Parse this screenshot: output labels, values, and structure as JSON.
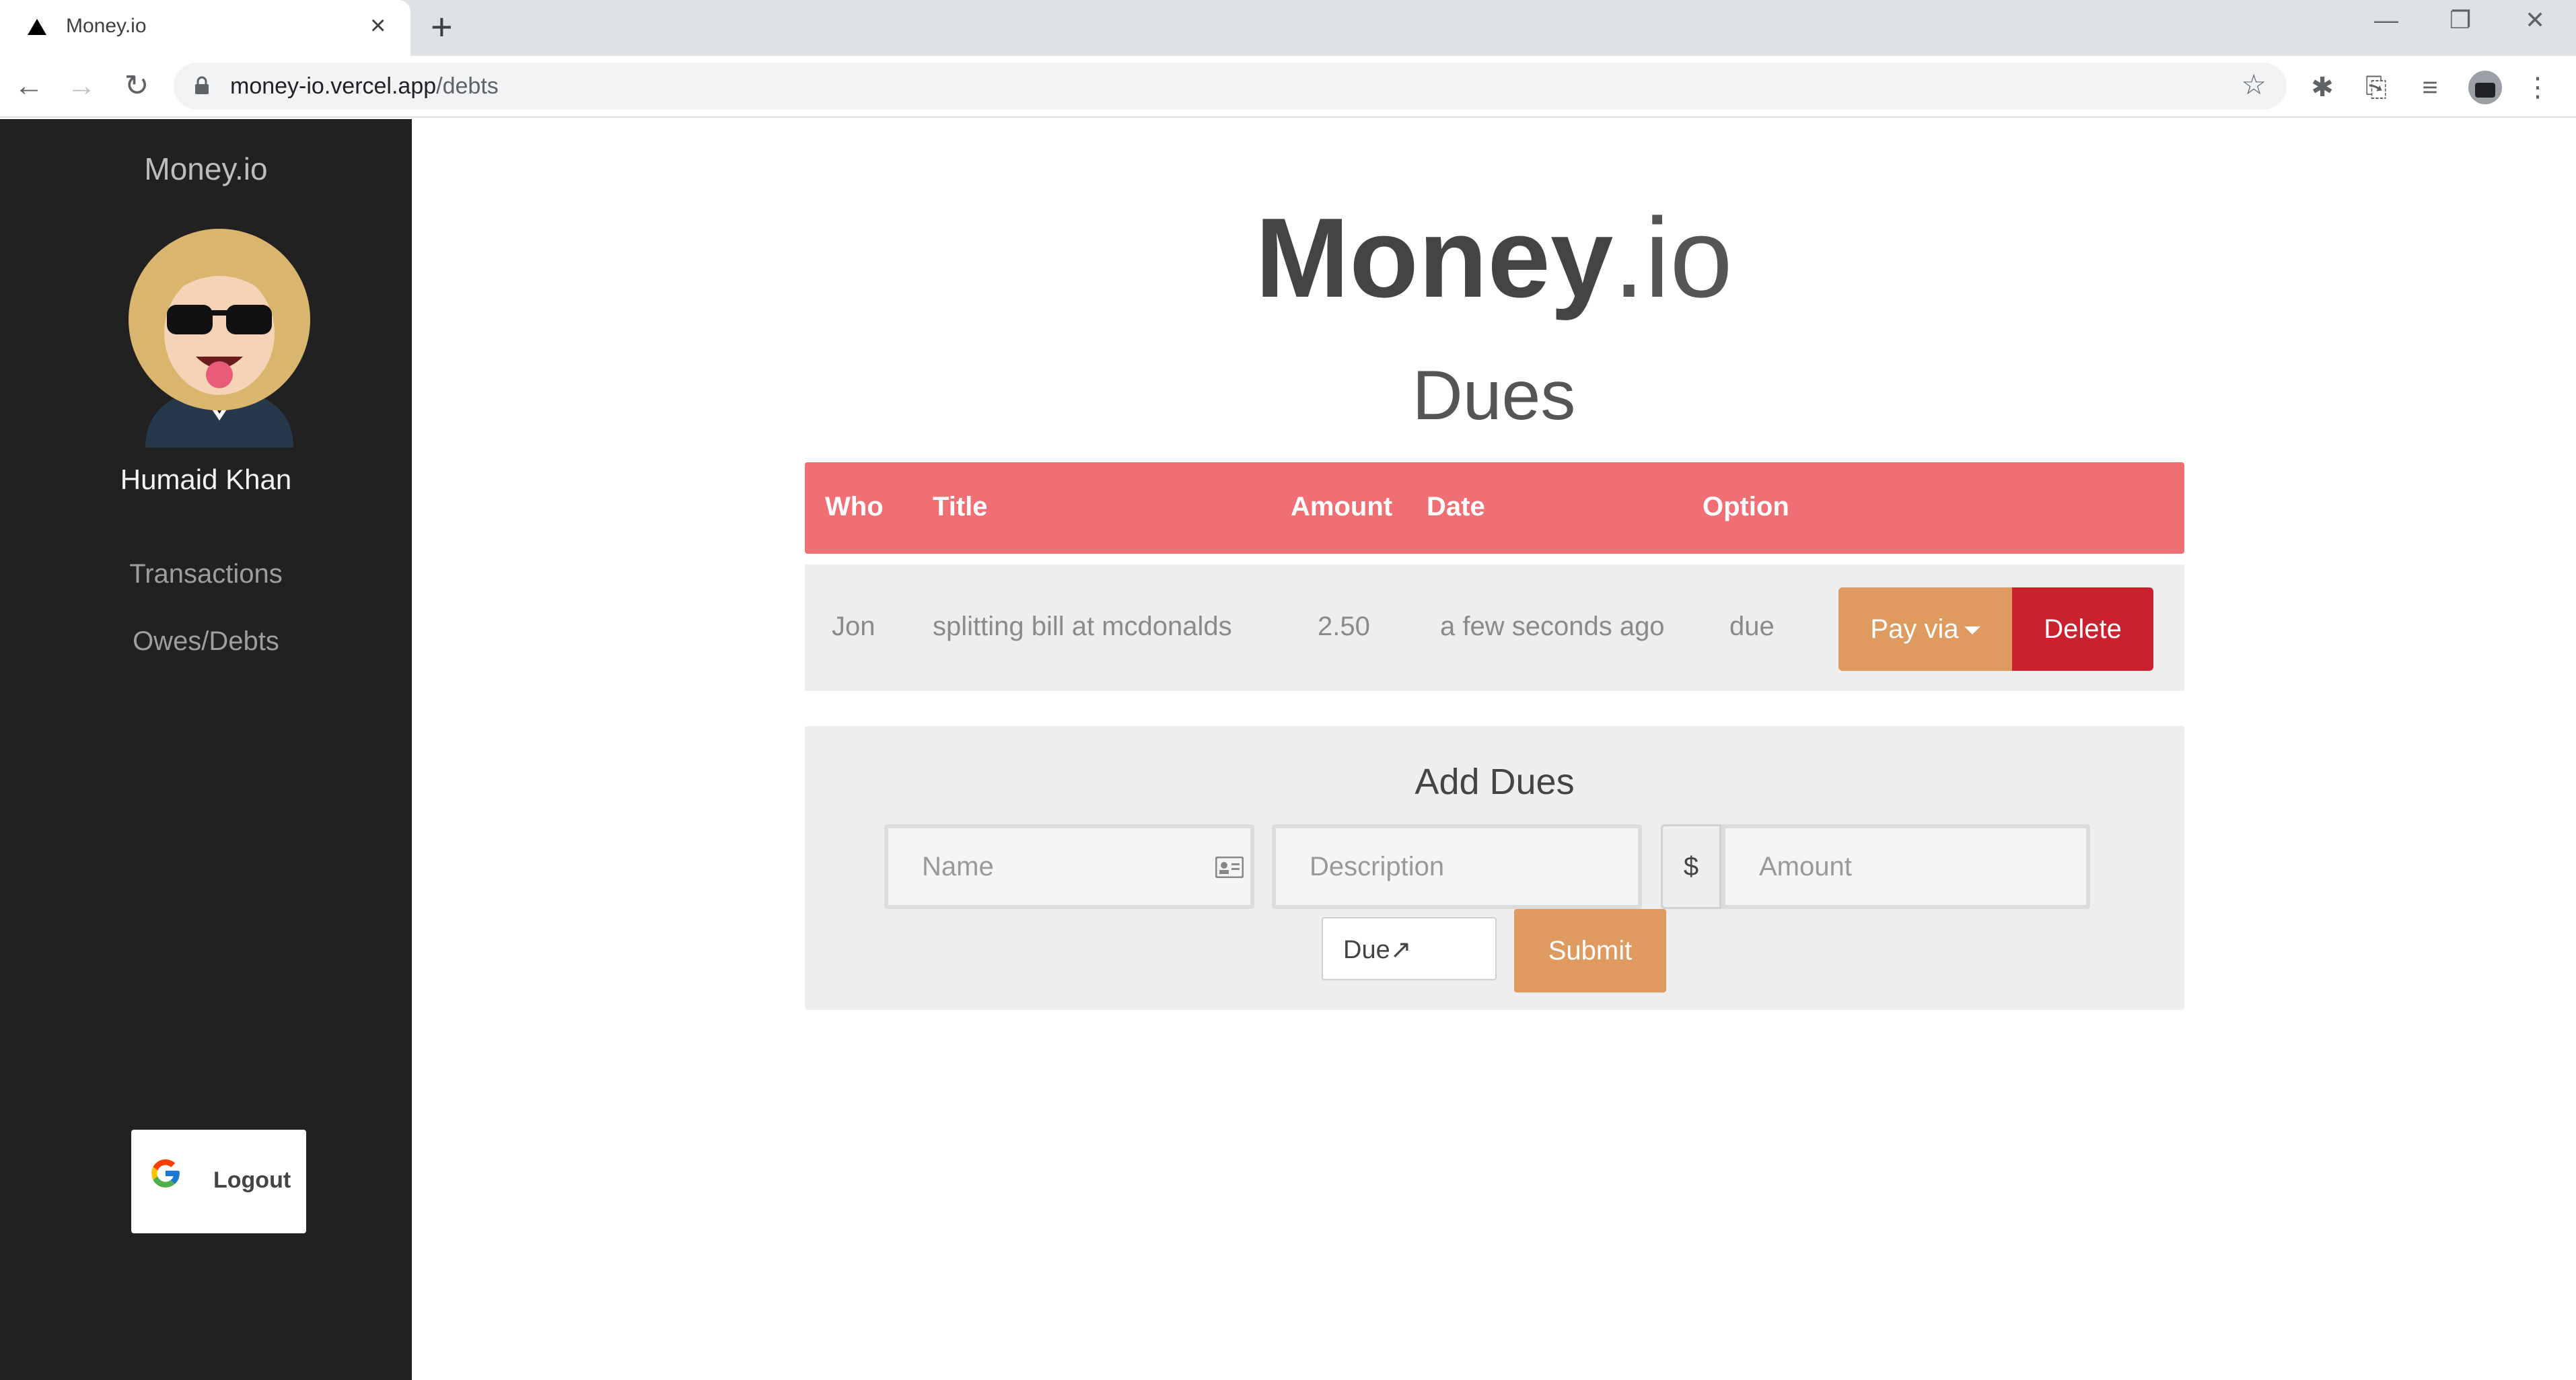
{
  "browser": {
    "tab_title": "Money.io",
    "url_host": "money-io.vercel.app",
    "url_path": "/debts"
  },
  "sidebar": {
    "brand": "Money.io",
    "user_name": "Humaid Khan",
    "links": [
      "Transactions",
      "Owes/Debts"
    ],
    "logout_label": "Logout"
  },
  "main": {
    "logo_bold": "Money",
    "logo_light": ".io",
    "section_title": "Dues"
  },
  "table": {
    "headers": [
      "Who",
      "Title",
      "Amount",
      "Date",
      "Option"
    ],
    "rows": [
      {
        "who": "Jon",
        "title": "splitting bill at mcdonalds",
        "amount": "2.50",
        "date": "a few seconds ago",
        "option": "due"
      }
    ],
    "pay_label": "Pay via",
    "delete_label": "Delete"
  },
  "add_form": {
    "title": "Add Dues",
    "name_placeholder": "Name",
    "description_placeholder": "Description",
    "currency_symbol": "$",
    "amount_placeholder": "Amount",
    "type_value": "Due↗",
    "submit_label": "Submit"
  },
  "colors": {
    "sidebar_bg": "#212121",
    "table_header": "#ef6f74",
    "accent_orange": "#df9a5f",
    "danger_red": "#c9222f",
    "panel_bg": "#eeeeee"
  }
}
